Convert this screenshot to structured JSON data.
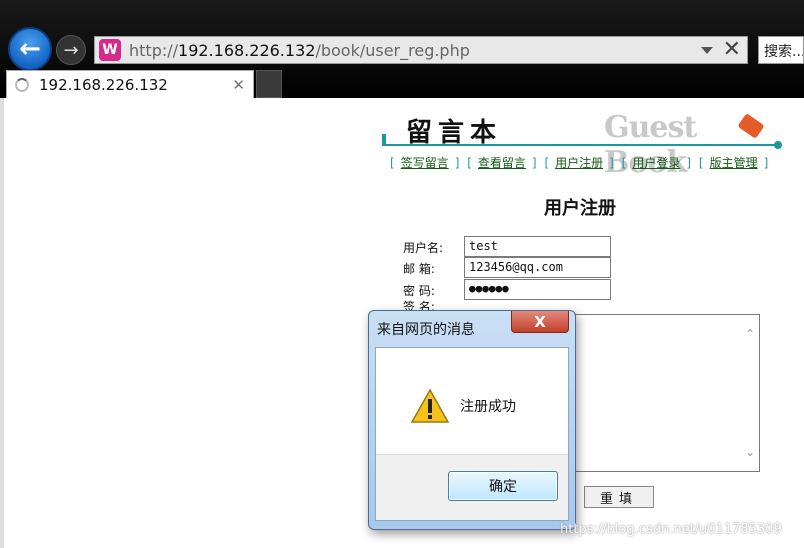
{
  "browser": {
    "url_scheme": "http://",
    "url_host": "192.168.226.132",
    "url_path": "/book/user_reg.php",
    "search_label": "搜索...",
    "tab_title": "192.168.226.132"
  },
  "site": {
    "logo_cn": "留言本",
    "logo_en": "Guest Book",
    "menu": [
      "签写留言",
      "查看留言",
      "用户注册",
      "用户登录",
      "版主管理"
    ]
  },
  "form": {
    "heading": "用户注册",
    "username_label": "用户名:",
    "username_value": "test",
    "email_label": "邮  箱:",
    "email_value": "123456@qq.com",
    "password_label": "密  码:",
    "password_value": "●●●●●●",
    "signature_label": "签  名:",
    "reset_label": "重填"
  },
  "dialog": {
    "title": "来自网页的消息",
    "message": "注册成功",
    "ok_label": "确定",
    "close_glyph": "X"
  },
  "watermark": "https://blog.csdn.net/u011785309"
}
